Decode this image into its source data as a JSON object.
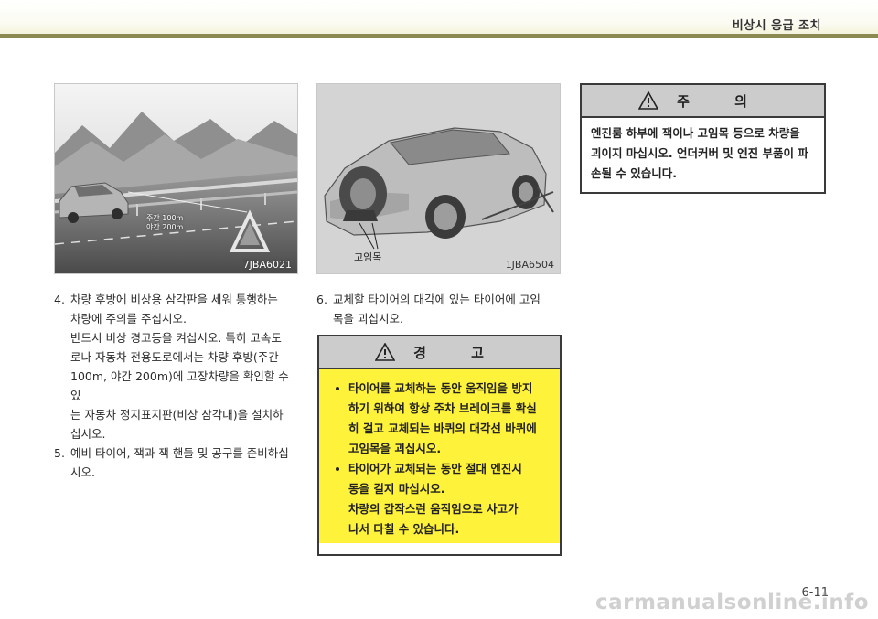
{
  "header": {
    "section_title": "비상시 응급 조치"
  },
  "figure_left": {
    "sign_text_line1": "주간 100m",
    "sign_text_line2": "야간 200m",
    "code": "7JBA6021"
  },
  "figure_right": {
    "callout": "고임목",
    "code": "1JBA6504"
  },
  "steps": [
    {
      "num": "4.",
      "lines": [
        "차량 후방에 비상용 삼각판을 세워 통행하는",
        "차량에 주의를 주십시오."
      ]
    },
    {
      "num": "",
      "lines": [
        "반드시 비상 경고등을 켜십시오. 특히 고속도",
        "로나 자동차 전용도로에서는 차량 후방(주간",
        "100m, 야간 200m)에 고장차량을 확인할 수 있",
        "는 자동차 정지표지판(비상 삼각대)을 설치하",
        "십시오."
      ]
    },
    {
      "num": "5.",
      "lines": [
        "예비 타이어, 잭과 잭 핸들 및 공구를 준비하십",
        "시오."
      ]
    }
  ],
  "step6": {
    "num": "6.",
    "lines": [
      "교체할 타이어의 대각에 있는 타이어에 고임",
      "목을 괴십시오."
    ]
  },
  "warning": {
    "title": "경 고",
    "bullets": [
      [
        "타이어를 교체하는 동안 움직임을 방지",
        "하기 위하여 항상 주차 브레이크를 확실",
        "히 걸고 교체되는 바퀴의 대각선 바퀴에",
        "고임목을 괴십시오."
      ],
      [
        "타이어가 교체되는 동안 절대 엔진시",
        "동을 걸지 마십시오.",
        "차량의 갑작스런 움직임으로 사고가",
        "나서 다칠 수 있습니다."
      ]
    ]
  },
  "caution": {
    "title": "주 의",
    "lines": [
      "엔진룸 하부에 잭이나 고임목 등으로 차량을",
      "괴이지 마십시오. 언더커버 및 엔진 부품이 파",
      "손될 수 있습니다."
    ]
  },
  "page_number": "6-11",
  "watermark": "carmanualsonline.info",
  "colors": {
    "rule": "#8b8a52",
    "warning_fill": "#fff23a",
    "box_head": "#cccccc"
  }
}
